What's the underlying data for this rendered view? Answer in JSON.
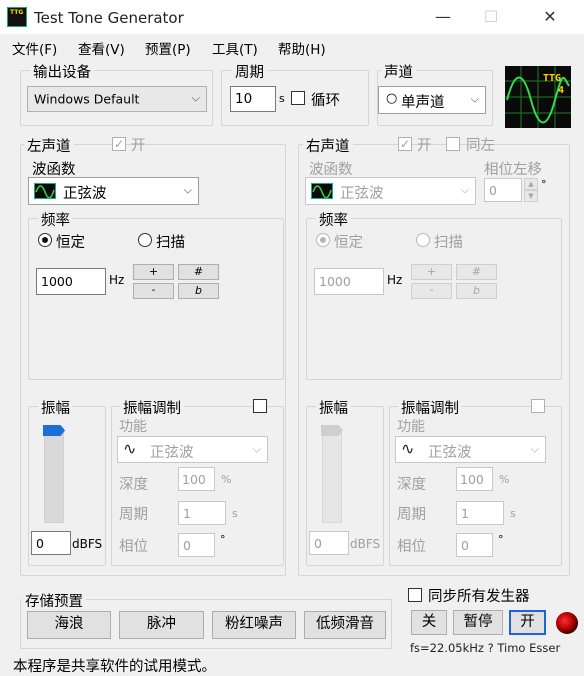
{
  "window": {
    "title": "Test Tone Generator",
    "icon_text": "TTG"
  },
  "menu": [
    "文件(F)",
    "查看(V)",
    "预置(P)",
    "工具(T)",
    "帮助(H)"
  ],
  "output": {
    "title": "输出设备",
    "device": "Windows Default"
  },
  "period": {
    "title": "周期",
    "value": "10",
    "unit": "s",
    "loop_label": "循环",
    "loop_checked": false
  },
  "channel": {
    "title": "声道",
    "mode": "单声道"
  },
  "logo": {
    "line1": "TTG",
    "line2": "4"
  },
  "left": {
    "title": "左声道",
    "on_label": "开",
    "on_checked": true,
    "waveform_label": "波函数",
    "waveform": "正弦波",
    "freq": {
      "title": "频率",
      "constant": "恒定",
      "sweep": "扫描",
      "selected": "constant",
      "value": "1000",
      "unit": "Hz",
      "plus": "+",
      "minus": "-",
      "sharp": "#",
      "flat": "b"
    },
    "amp": {
      "title": "振幅",
      "value": "0",
      "unit": "dBFS",
      "level": 1.0
    },
    "am": {
      "title": "振幅调制",
      "checked": false,
      "func_label": "功能",
      "func": "正弦波",
      "depth_label": "深度",
      "depth": "100",
      "depth_unit": "%",
      "period_label": "周期",
      "period": "1",
      "period_unit": "s",
      "phase_label": "相位",
      "phase": "0",
      "phase_unit": "°"
    }
  },
  "right": {
    "title": "右声道",
    "on_label": "开",
    "on_checked": true,
    "same_label": "同左",
    "same_checked": false,
    "waveform_label": "波函数",
    "waveform": "正弦波",
    "phase_shift_label": "相位左移",
    "phase_shift": "0",
    "phase_unit": "°",
    "freq": {
      "title": "频率",
      "constant": "恒定",
      "sweep": "扫描",
      "selected": "constant",
      "value": "1000",
      "unit": "Hz",
      "plus": "+",
      "minus": "-",
      "sharp": "#",
      "flat": "b"
    },
    "amp": {
      "title": "振幅",
      "value": "0",
      "unit": "dBFS",
      "level": 1.0
    },
    "am": {
      "title": "振幅调制",
      "checked": false,
      "func_label": "功能",
      "func": "正弦波",
      "depth_label": "深度",
      "depth": "100",
      "depth_unit": "%",
      "period_label": "周期",
      "period": "1",
      "period_unit": "s",
      "phase_label": "相位",
      "phase": "0",
      "phase_unit": "°"
    }
  },
  "presets": {
    "title": "存储预置",
    "buttons": [
      "海浪",
      "脉冲",
      "粉红噪声",
      "低频滑音"
    ]
  },
  "sync": {
    "label": "同步所有发生器",
    "checked": false,
    "off": "关",
    "pause": "暂停",
    "on": "开"
  },
  "info": "fs=22.05kHz ? Timo Esser",
  "status": "本程序是共享软件的试用模式。",
  "colors": {
    "slider_active": "#1a6fd8",
    "led": "#c00000",
    "on_button_border": "#1e66d6"
  }
}
